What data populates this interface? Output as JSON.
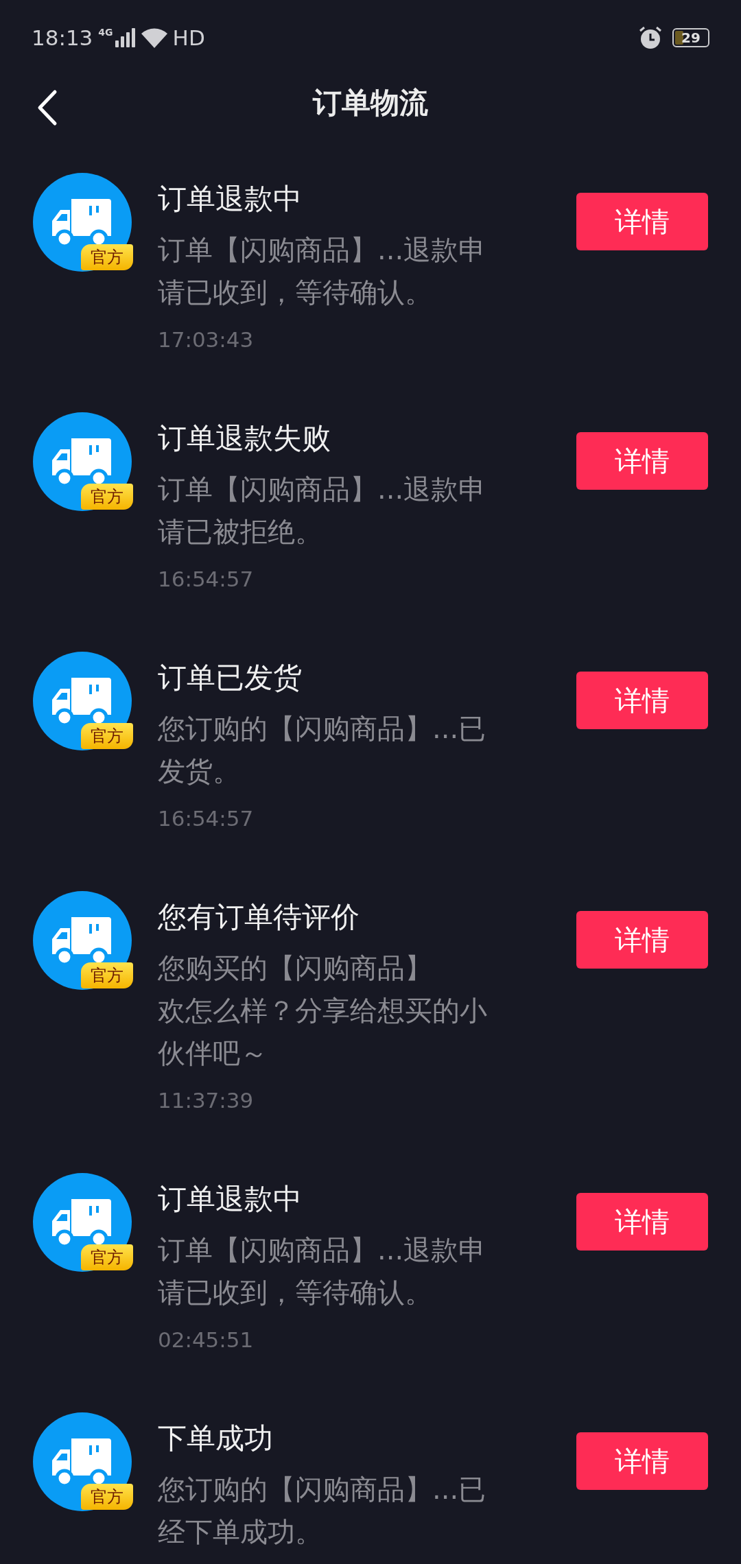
{
  "status_bar": {
    "time": "18:13",
    "network": "4G",
    "hd": "HD",
    "battery": "29"
  },
  "header": {
    "title": "订单物流"
  },
  "messages": [
    {
      "title": "订单退款中",
      "lines": [
        "订单【闪购商品】...退款申",
        "请已收到，等待确认。"
      ],
      "time": "17:03:43",
      "badge": "官方",
      "button": "详情"
    },
    {
      "title": "订单退款失败",
      "lines": [
        "订单【闪购商品】...退款申",
        "请已被拒绝。"
      ],
      "time": "16:54:57",
      "badge": "官方",
      "button": "详情"
    },
    {
      "title": "订单已发货",
      "lines": [
        "您订购的【闪购商品】...已",
        "发货。"
      ],
      "time": "16:54:57",
      "badge": "官方",
      "button": "详情"
    },
    {
      "title": "您有订单待评价",
      "lines": [
        "您购买的【闪购商品】",
        "欢怎么样？分享给想买的小",
        "伙伴吧～"
      ],
      "time": "11:37:39",
      "badge": "官方",
      "button": "详情"
    },
    {
      "title": "订单退款中",
      "lines": [
        "订单【闪购商品】...退款申",
        "请已收到，等待确认。"
      ],
      "time": "02:45:51",
      "badge": "官方",
      "button": "详情"
    },
    {
      "title": "下单成功",
      "lines": [
        "您订购的【闪购商品】...已",
        "经下单成功。"
      ],
      "badge": "官方",
      "button": "详情"
    }
  ]
}
